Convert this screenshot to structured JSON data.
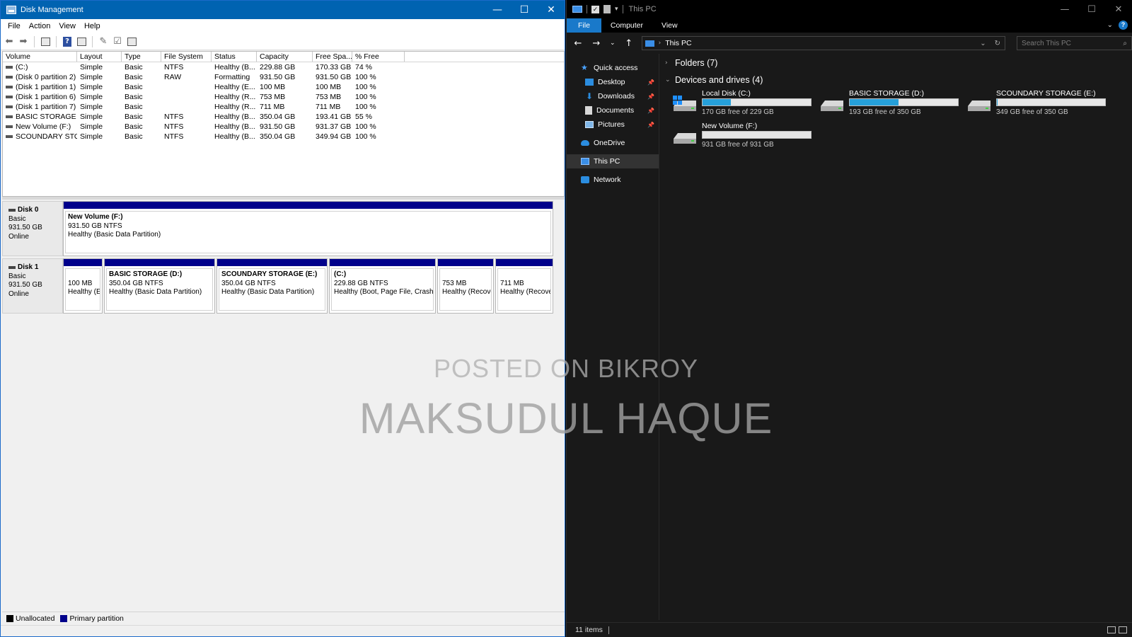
{
  "disk_management": {
    "title": "Disk Management",
    "menu": [
      "File",
      "Action",
      "View",
      "Help"
    ],
    "columns": [
      "Volume",
      "Layout",
      "Type",
      "File System",
      "Status",
      "Capacity",
      "Free Spa...",
      "% Free"
    ],
    "rows": [
      [
        "(C:)",
        "Simple",
        "Basic",
        "NTFS",
        "Healthy (B...",
        "229.88 GB",
        "170.33 GB",
        "74 %"
      ],
      [
        "(Disk 0 partition 2)",
        "Simple",
        "Basic",
        "RAW",
        "Formatting",
        "931.50 GB",
        "931.50 GB",
        "100 %"
      ],
      [
        "(Disk 1 partition 1)",
        "Simple",
        "Basic",
        "",
        "Healthy (E...",
        "100 MB",
        "100 MB",
        "100 %"
      ],
      [
        "(Disk 1 partition 6)",
        "Simple",
        "Basic",
        "",
        "Healthy (R...",
        "753 MB",
        "753 MB",
        "100 %"
      ],
      [
        "(Disk 1 partition 7)",
        "Simple",
        "Basic",
        "",
        "Healthy (R...",
        "711 MB",
        "711 MB",
        "100 %"
      ],
      [
        "BASIC STORAGE (D:)",
        "Simple",
        "Basic",
        "NTFS",
        "Healthy (B...",
        "350.04 GB",
        "193.41 GB",
        "55 %"
      ],
      [
        "New Volume (F:)",
        "Simple",
        "Basic",
        "NTFS",
        "Healthy (B...",
        "931.50 GB",
        "931.37 GB",
        "100 %"
      ],
      [
        "SCOUNDARY STO...",
        "Simple",
        "Basic",
        "NTFS",
        "Healthy (B...",
        "350.04 GB",
        "349.94 GB",
        "100 %"
      ]
    ],
    "disks": [
      {
        "name": "Disk 0",
        "type": "Basic",
        "size": "931.50 GB",
        "state": "Online",
        "partitions": [
          {
            "name": "New Volume  (F:)",
            "size": "931.50 GB NTFS",
            "status": "Healthy (Basic Data Partition)"
          }
        ]
      },
      {
        "name": "Disk 1",
        "type": "Basic",
        "size": "931.50 GB",
        "state": "Online",
        "partitions": [
          {
            "name": "",
            "size": "100 MB",
            "status": "Healthy (E"
          },
          {
            "name": "BASIC STORAGE  (D:)",
            "size": "350.04 GB NTFS",
            "status": "Healthy (Basic Data Partition)"
          },
          {
            "name": "SCOUNDARY STORAGE  (E:)",
            "size": "350.04 GB NTFS",
            "status": "Healthy (Basic Data Partition)"
          },
          {
            "name": "(C:)",
            "size": "229.88 GB NTFS",
            "status": "Healthy (Boot, Page File, Crash D"
          },
          {
            "name": "",
            "size": "753 MB",
            "status": "Healthy (Recove"
          },
          {
            "name": "",
            "size": "711 MB",
            "status": "Healthy (Recove"
          }
        ]
      }
    ],
    "legend": [
      {
        "label": "Unallocated",
        "color": "#000000"
      },
      {
        "label": "Primary partition",
        "color": "#00008b"
      }
    ]
  },
  "explorer": {
    "title": "This PC",
    "ribbon_tabs": [
      "File",
      "Computer",
      "View"
    ],
    "address": "This PC",
    "search_placeholder": "Search This PC",
    "nav": [
      "Quick access",
      "Desktop",
      "Downloads",
      "Documents",
      "Pictures",
      "OneDrive",
      "This PC",
      "Network"
    ],
    "folders_header": "Folders (7)",
    "devices_header": "Devices and drives (4)",
    "drives": [
      {
        "name": "Local Disk (C:)",
        "free": "170 GB free of 229 GB",
        "used_fraction": 0.26
      },
      {
        "name": "BASIC STORAGE (D:)",
        "free": "193 GB free of 350 GB",
        "used_fraction": 0.45
      },
      {
        "name": "SCOUNDARY STORAGE (E:)",
        "free": "349 GB free of 350 GB",
        "used_fraction": 0.003
      },
      {
        "name": "New Volume (F:)",
        "free": "931 GB free of 931 GB",
        "used_fraction": 0.0
      }
    ],
    "status": "11 items",
    "accent": "#1979ca"
  },
  "watermark": {
    "line1": "POSTED ON BIKROY",
    "line2": "MAKSUDUL HAQUE"
  }
}
